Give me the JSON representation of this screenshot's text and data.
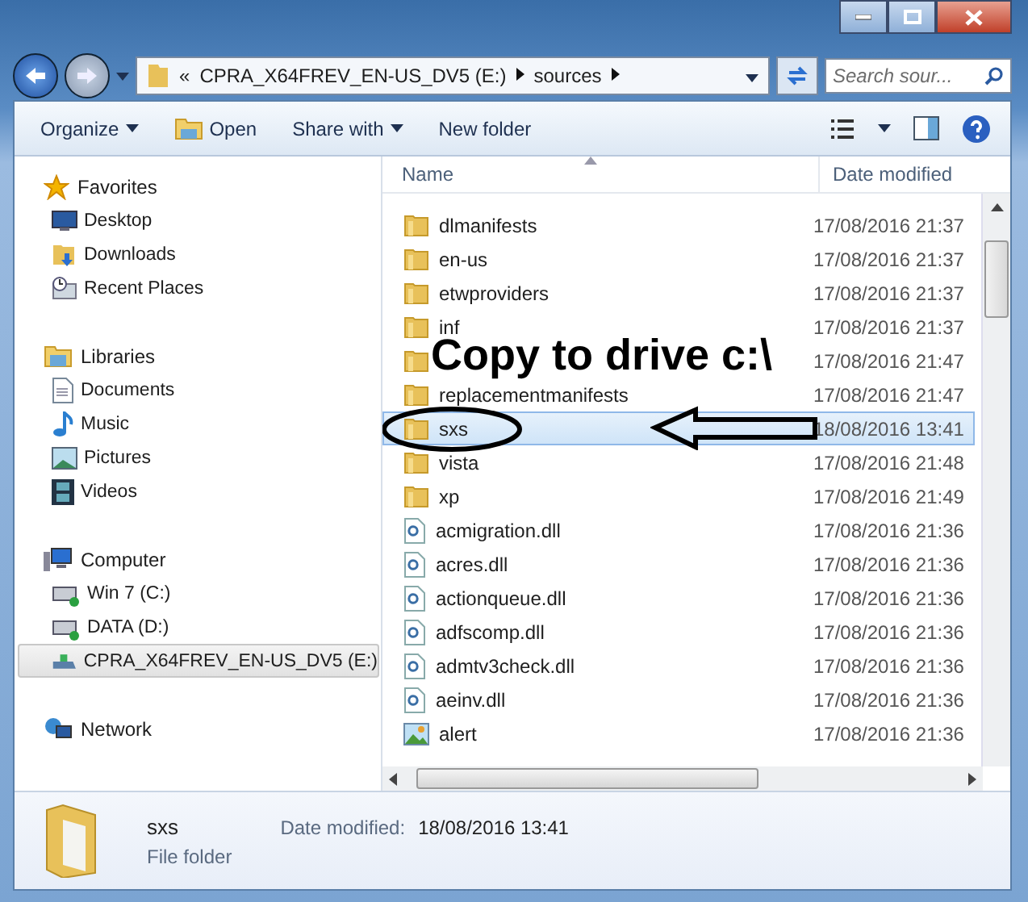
{
  "address_bar": {
    "segments": [
      "«",
      "CPRA_X64FREV_EN-US_DV5 (E:)",
      "sources"
    ]
  },
  "search": {
    "placeholder": "Search sour..."
  },
  "toolbar": [
    {
      "label": "Organize",
      "kind": "menu"
    },
    {
      "label": "Open",
      "kind": "open"
    },
    {
      "label": "Share with",
      "kind": "menu"
    },
    {
      "label": "New folder",
      "kind": "plain"
    }
  ],
  "sidebar": [
    {
      "label": "Favorites",
      "kind": "star",
      "children": [
        {
          "label": "Desktop",
          "kind": "desktop",
          "selected": false
        },
        {
          "label": "Downloads",
          "kind": "downloads",
          "selected": false
        },
        {
          "label": "Recent Places",
          "kind": "recent",
          "selected": false
        }
      ]
    },
    {
      "label": "Libraries",
      "kind": "library",
      "children": [
        {
          "label": "Documents",
          "kind": "document",
          "selected": false
        },
        {
          "label": "Music",
          "kind": "music",
          "selected": false
        },
        {
          "label": "Pictures",
          "kind": "pictures",
          "selected": false
        },
        {
          "label": "Videos",
          "kind": "videos",
          "selected": false
        }
      ]
    },
    {
      "label": "Computer",
      "kind": "computer",
      "children": [
        {
          "label": "Win 7 (C:)",
          "kind": "drive",
          "selected": false
        },
        {
          "label": "DATA (D:)",
          "kind": "drive",
          "selected": false
        },
        {
          "label": "CPRA_X64FREV_EN-US_DV5 (E:)",
          "kind": "disc",
          "selected": true
        }
      ]
    },
    {
      "label": "Network",
      "kind": "network"
    }
  ],
  "file_list": {
    "columns": [
      "Name",
      "Date modified"
    ],
    "rows": [
      {
        "name": "dlmanifests",
        "date": "17/08/2016 21:37",
        "kind": "folder",
        "selected": false
      },
      {
        "name": "en-us",
        "date": "17/08/2016 21:37",
        "kind": "folder",
        "selected": false
      },
      {
        "name": "etwproviders",
        "date": "17/08/2016 21:37",
        "kind": "folder",
        "selected": false
      },
      {
        "name": "inf",
        "date": "17/08/2016 21:37",
        "kind": "folder",
        "selected": false
      },
      {
        "date": "17/08/2016 21:47",
        "kind": "folder",
        "selected": false
      },
      {
        "name": "replacementmanifests",
        "date": "17/08/2016 21:47",
        "kind": "folder",
        "selected": false
      },
      {
        "name": "sxs",
        "date": "18/08/2016 13:41",
        "kind": "folder",
        "selected": true
      },
      {
        "name": "vista",
        "date": "17/08/2016 21:48",
        "kind": "folder",
        "selected": false
      },
      {
        "name": "xp",
        "date": "17/08/2016 21:49",
        "kind": "folder",
        "selected": false
      },
      {
        "name": "acmigration.dll",
        "date": "17/08/2016 21:36",
        "kind": "dll",
        "selected": false
      },
      {
        "name": "acres.dll",
        "date": "17/08/2016 21:36",
        "kind": "dll",
        "selected": false
      },
      {
        "name": "actionqueue.dll",
        "date": "17/08/2016 21:36",
        "kind": "dll",
        "selected": false
      },
      {
        "name": "adfscomp.dll",
        "date": "17/08/2016 21:36",
        "kind": "dll",
        "selected": false
      },
      {
        "name": "admtv3check.dll",
        "date": "17/08/2016 21:36",
        "kind": "dll",
        "selected": false
      },
      {
        "name": "aeinv.dll",
        "date": "17/08/2016 21:36",
        "kind": "dll",
        "selected": false
      },
      {
        "name": "alert",
        "date": "17/08/2016 21:36",
        "kind": "image",
        "selected": false
      }
    ]
  },
  "annotation": {
    "text": "Copy to drive c:\\"
  },
  "details_pane": {
    "name": "sxs",
    "type": "File folder",
    "date_label": "Date modified:",
    "date": "18/08/2016 13:41"
  }
}
